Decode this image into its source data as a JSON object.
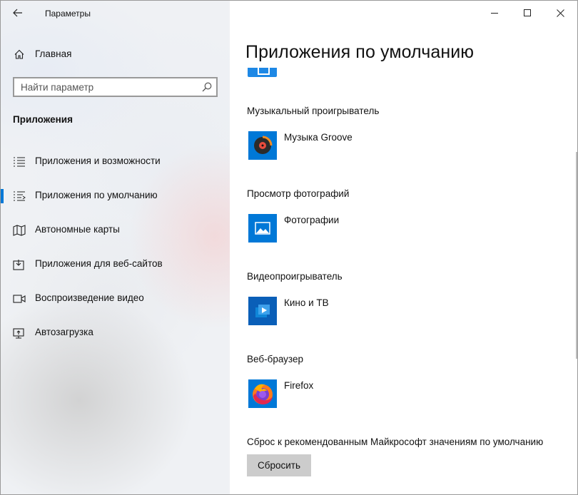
{
  "window": {
    "title": "Параметры",
    "controls": {
      "minimize": "minimize-icon",
      "maximize": "maximize-icon",
      "close": "close-icon"
    }
  },
  "sidebar": {
    "back_icon": "back-arrow-icon",
    "home_label": "Главная",
    "search": {
      "placeholder": "Найти параметр",
      "value": ""
    },
    "section_title": "Приложения",
    "items": [
      {
        "label": "Приложения и возможности",
        "icon": "apps-list-icon",
        "active": false
      },
      {
        "label": "Приложения по умолчанию",
        "icon": "default-apps-icon",
        "active": true
      },
      {
        "label": "Автономные карты",
        "icon": "map-icon",
        "active": false
      },
      {
        "label": "Приложения для веб-сайтов",
        "icon": "web-apps-icon",
        "active": false
      },
      {
        "label": "Воспроизведение видео",
        "icon": "video-icon",
        "active": false
      },
      {
        "label": "Автозагрузка",
        "icon": "startup-icon",
        "active": false
      }
    ]
  },
  "main": {
    "title": "Приложения по умолчанию",
    "groups": [
      {
        "label": "Музыкальный проигрыватель",
        "app": "Музыка Groove",
        "icon": "groove-music-icon"
      },
      {
        "label": "Просмотр фотографий",
        "app": "Фотографии",
        "icon": "photos-icon"
      },
      {
        "label": "Видеопроигрыватель",
        "app": "Кино и ТВ",
        "icon": "movies-tv-icon"
      },
      {
        "label": "Веб-браузер",
        "app": "Firefox",
        "icon": "firefox-icon"
      }
    ],
    "reset": {
      "label": "Сброс к рекомендованным Майкрософт значениям по умолчанию",
      "button": "Сбросить"
    }
  },
  "colors": {
    "accent": "#0078d7",
    "button_bg": "#cccccc"
  }
}
